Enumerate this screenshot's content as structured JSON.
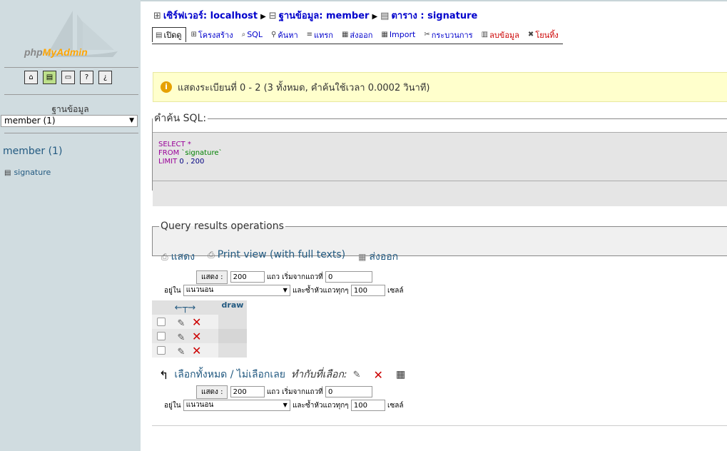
{
  "sidebar": {
    "logo_prefix": "php",
    "logo_name": "MyAdmin",
    "database_label": "ฐานข้อมูล",
    "database_select_value": "member (1)",
    "database_name": "member (1)",
    "tables": [
      {
        "label": "signature"
      }
    ]
  },
  "breadcrumb": {
    "server": "เซิร์ฟเวอร์: localhost",
    "database": "ฐานข้อมูล: member",
    "table": "ตาราง : signature"
  },
  "tabs": [
    {
      "label": "เปิดดู"
    },
    {
      "label": "โครงสร้าง"
    },
    {
      "label": "SQL"
    },
    {
      "label": "ค้นหา"
    },
    {
      "label": "แทรก"
    },
    {
      "label": "ส่งออก"
    },
    {
      "label": "Import"
    },
    {
      "label": "กระบวนการ"
    },
    {
      "label": "ลบข้อมูล"
    },
    {
      "label": "โยนทิ้ง"
    }
  ],
  "notice": {
    "icon": "info-icon",
    "text": "แสดงระเบียนที่ 0 - 2 (3 ทั้งหมด, คำค้นใช้เวลา 0.0002 วินาที)"
  },
  "sql": {
    "legend": "คำค้น SQL:",
    "select_kw": "SELECT",
    "select_rest": " *",
    "from_kw": "FROM",
    "from_table": " `signature`",
    "limit_kw": "LIMIT",
    "limit_rest": " 0 , 200"
  },
  "qro": {
    "legend": "Query results operations",
    "show": "แสดง",
    "print_view": "Print view (with full texts)",
    "export": "ส่งออก"
  },
  "nav": {
    "show_button": "แสดง :",
    "rows_value": "200",
    "start_label": "แถว เริ่มจากแถวที่",
    "start_value": "0",
    "in_label": "อยู่ใน",
    "mode_value": "แนวนอน",
    "repeat_label": "และซ้ำหัวแถวทุกๆ",
    "repeat_value": "100",
    "cells_label": "เซลล์"
  },
  "table": {
    "column_arrows": "←┬→",
    "column_header": "draw",
    "rows": [
      {},
      {},
      {}
    ]
  },
  "bulk": {
    "select_all": "เลือกทั้งหมด / ไม่เลือกเลย",
    "with_selected": "ทำกับที่เลือก:"
  }
}
